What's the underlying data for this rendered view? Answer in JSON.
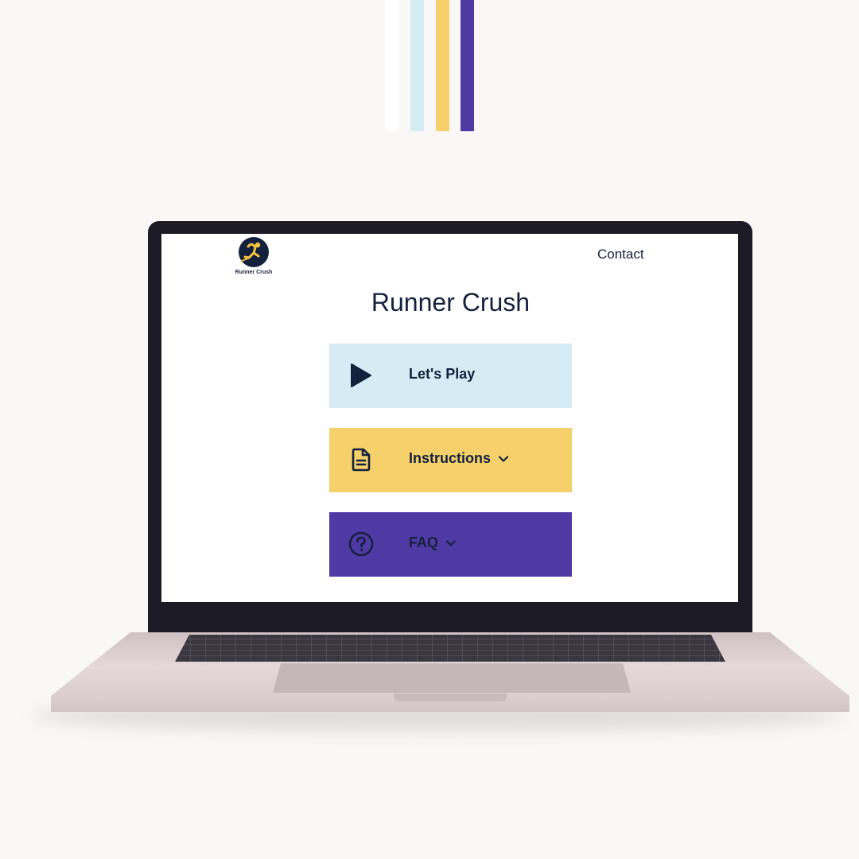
{
  "colors": {
    "background": "#f9f8f6",
    "navy": "#14213d",
    "light_blue": "#d6ecf5",
    "yellow": "#f5d06b",
    "purple": "#4f3aa5",
    "white_stripe": "#ffffff"
  },
  "decor": {
    "stripes": [
      "#ffffff",
      "#d6ecf5",
      "#f5d06b",
      "#4f3aa5"
    ]
  },
  "site": {
    "logo_text": "Runner Crush",
    "nav": {
      "contact_label": "Contact"
    },
    "title": "Runner Crush",
    "menu": [
      {
        "label": "Let's Play",
        "icon": "play-icon",
        "color": "#d6ecf5",
        "has_dropdown": false
      },
      {
        "label": "Instructions",
        "icon": "document-icon",
        "color": "#f5d06b",
        "has_dropdown": true
      },
      {
        "label": "FAQ",
        "icon": "question-circle-icon",
        "color": "#4f3aa5",
        "has_dropdown": true
      }
    ]
  }
}
